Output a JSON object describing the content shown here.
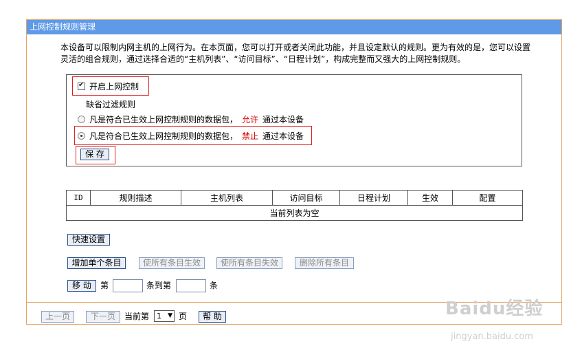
{
  "window": {
    "title": "上网控制规则管理"
  },
  "description": "本设备可以限制内网主机的上网行为。在本页面，您可以打开或者关闭此功能，并且设定默认的规则。更为有效的是，您可以设置灵活的组合规则，通过选择合适的“主机列表”、“访问目标”、“日程计划”，构成完整而又强大的上网控制规则。",
  "settings": {
    "enable_label": "开启上网控制",
    "enable_checked": true,
    "default_rule_title": "缺省过滤规则",
    "option_allow": {
      "prefix": "凡是符合已生效上网控制规则的数据包，",
      "keyword": "允许",
      "suffix": "通过本设备",
      "selected": false
    },
    "option_deny": {
      "prefix": "凡是符合已生效上网控制规则的数据包，",
      "keyword": "禁止",
      "suffix": "通过本设备",
      "selected": true
    },
    "save_label": "保 存"
  },
  "table": {
    "headers": [
      "ID",
      "规则描述",
      "主机列表",
      "访问目标",
      "日程计划",
      "生效",
      "配置"
    ],
    "empty_text": "当前列表为空"
  },
  "actions": {
    "quick_setup": "快速设置",
    "add_entry": "增加单个条目",
    "enable_all": "使所有条目生效",
    "disable_all": "使所有条目失效",
    "delete_all": "删除所有条目",
    "move": "移 动",
    "move_prefix": "第",
    "move_middle": "条到第",
    "move_suffix": "条"
  },
  "pagination": {
    "prev": "上一页",
    "next": "下一页",
    "current_prefix": "当前第",
    "current_page": "1",
    "page_suffix": "页",
    "help": "帮 助"
  },
  "watermark": {
    "brand": "Baidu经验",
    "url": "jingyan.baidu.com"
  },
  "colors": {
    "title_bar": "#5f9ae8",
    "border": "#e7a464",
    "highlight_red": "#d40000",
    "callout_red": "#e02020"
  }
}
